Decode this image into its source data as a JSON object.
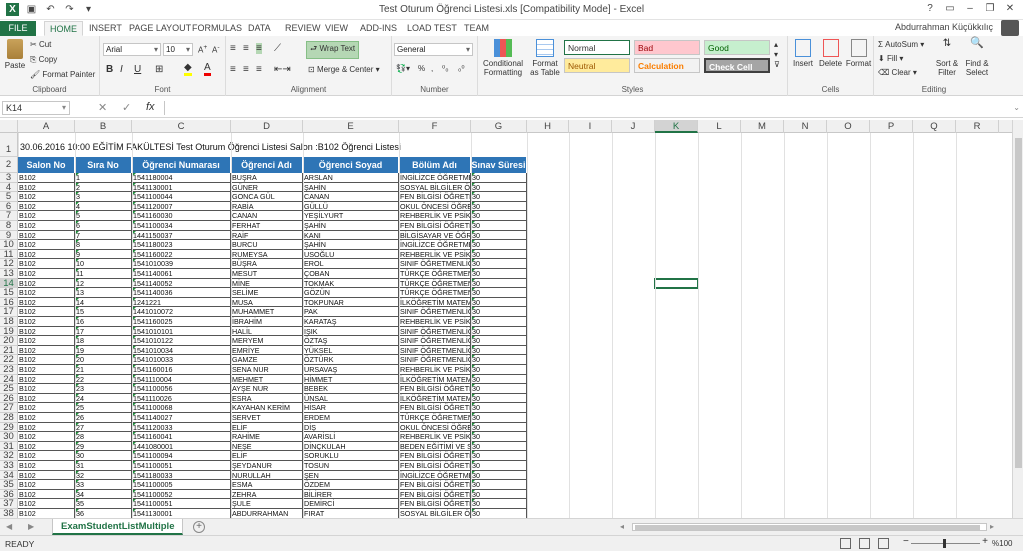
{
  "window": {
    "title": "Test Oturum  Öğrenci Listesi.xls  [Compatibility Mode] - Excel",
    "user": "Abdurrahman Küçükkılıç"
  },
  "tabs": [
    "FILE",
    "HOME",
    "INSERT",
    "PAGE LAYOUT",
    "FORMULAS",
    "DATA",
    "REVIEW",
    "VIEW",
    "ADD-INS",
    "LOAD TEST",
    "TEAM"
  ],
  "ribbon": {
    "clipboard": {
      "paste": "Paste",
      "cut": "Cut",
      "copy": "Copy",
      "format_painter": "Format Painter",
      "label": "Clipboard"
    },
    "font": {
      "name": "Arial",
      "size": "10",
      "label": "Font",
      "bold": "B",
      "italic": "I",
      "underline": "U"
    },
    "alignment": {
      "wrap": "Wrap Text",
      "merge": "Merge & Center",
      "label": "Alignment"
    },
    "number": {
      "format": "General",
      "label": "Number",
      "pct": "%"
    },
    "styles": {
      "cond": "Conditional Formatting",
      "table": "Format as Table",
      "label": "Styles",
      "normal": "Normal",
      "bad": "Bad",
      "good": "Good",
      "neutral": "Neutral",
      "calculation": "Calculation",
      "check": "Check Cell"
    },
    "cells": {
      "insert": "Insert",
      "delete": "Delete",
      "format": "Format",
      "label": "Cells"
    },
    "editing": {
      "autosum": "AutoSum",
      "fill": "Fill",
      "clear": "Clear",
      "sort": "Sort & Filter",
      "find": "Find & Select",
      "label": "Editing"
    }
  },
  "formula_bar": {
    "name_box": "K14",
    "fx": "fx",
    "content": ""
  },
  "columns": [
    "A",
    "B",
    "C",
    "D",
    "E",
    "F",
    "G",
    "H",
    "I",
    "J",
    "K",
    "L",
    "M",
    "N",
    "O",
    "P",
    "Q",
    "R"
  ],
  "selected_column": "K",
  "selected_row": "14",
  "sheet_title": "30.06.2016 10:00 EĞİTİM FAKÜLTESİ Test Oturum  Öğrenci Listesi Salon :B102 Öğrenci Listesi",
  "table_headers": [
    "Salon No",
    "Sıra No",
    "Öğrenci Numarası",
    "Öğrenci Adı",
    "Öğrenci Soyad",
    "Bölüm Adı",
    "Sınav Süresi"
  ],
  "rows": [
    [
      "B102",
      "1",
      "1541180004",
      "BUŞRA",
      "ARSLAN",
      "İNGİLİZCE ÖĞRETMENLİĞİ",
      "30"
    ],
    [
      "B102",
      "2",
      "1541130001",
      "GÜNER",
      "ŞAHİN",
      "SOSYAL BİLGİLER ÖĞRETMENLİĞİ",
      "30"
    ],
    [
      "B102",
      "3",
      "1541100044",
      "GONCA GÜL",
      "CANAN",
      "FEN BİLGİSİ ÖĞRETMENLİĞİ",
      "30"
    ],
    [
      "B102",
      "4",
      "1541120007",
      "RABİA",
      "GÜLLÜ",
      "OKUL ÖNCESİ ÖĞRETMENLİĞİ",
      "30"
    ],
    [
      "B102",
      "5",
      "1541160030",
      "CANAN",
      "YEŞİLYURT",
      "REHBERLİK VE PSİKOLOJİK DAN.",
      "30"
    ],
    [
      "B102",
      "6",
      "1541100034",
      "FERHAT",
      "ŞAHİN",
      "FEN BİLGİSİ ÖĞRETMENLİĞİ",
      "30"
    ],
    [
      "B102",
      "7",
      "1441150037",
      "RAİF",
      "KANI",
      "BİLGİSAYAR VE ÖĞRETİM TEK.",
      "30"
    ],
    [
      "B102",
      "8",
      "1541180023",
      "BURCU",
      "ŞAHİN",
      "İNGİLİZCE ÖĞRETMENLİĞİ",
      "30"
    ],
    [
      "B102",
      "9",
      "1541160022",
      "RUMEYSA",
      "USOĞLU",
      "REHBERLİK VE PSİKOLOJİK DAN.",
      "30"
    ],
    [
      "B102",
      "10",
      "1541010039",
      "BÜŞRA",
      "EROL",
      "SINIF ÖĞRETMENLİĞİ",
      "30"
    ],
    [
      "B102",
      "11",
      "1541140061",
      "MESUT",
      "ÇOBAN",
      "TÜRKÇE ÖĞRETMENLİĞİ",
      "30"
    ],
    [
      "B102",
      "12",
      "1541140052",
      "MİNE",
      "TOKMAK",
      "TÜRKÇE ÖĞRETMENLİĞİ",
      "30"
    ],
    [
      "B102",
      "13",
      "1541140036",
      "SELİME",
      "GÖZÜN",
      "TÜRKÇE ÖĞRETMENLİĞİ",
      "30"
    ],
    [
      "B102",
      "14",
      "1241221",
      "MUSA",
      "TOKPUNAR",
      "İLKÖĞRETİM MATEMATİK",
      "30"
    ],
    [
      "B102",
      "15",
      "1441010072",
      "MUHAMMET",
      "PAK",
      "SINIF ÖĞRETMENLİĞİ",
      "30"
    ],
    [
      "B102",
      "16",
      "1541160025",
      "İBRAHİM",
      "KARATAŞ",
      "REHBERLİK VE PSİKOLOJİK DAN.",
      "30"
    ],
    [
      "B102",
      "17",
      "1541010101",
      "HALİL",
      "IŞIK",
      "SINIF ÖĞRETMENLİĞİ",
      "30"
    ],
    [
      "B102",
      "18",
      "1541010122",
      "MERYEM",
      "ÖZTAŞ",
      "SINIF ÖĞRETMENLİĞİ",
      "30"
    ],
    [
      "B102",
      "19",
      "1541010034",
      "EMRİYE",
      "YÜKSEL",
      "SINIF ÖĞRETMENLİĞİ",
      "30"
    ],
    [
      "B102",
      "20",
      "1541010033",
      "GAMZE",
      "ÖZTÜRK",
      "SINIF ÖĞRETMENLİĞİ",
      "30"
    ],
    [
      "B102",
      "21",
      "1541160016",
      "SENA NUR",
      "URSAVAŞ",
      "REHBERLİK VE PSİKOLOJİK DAN.",
      "30"
    ],
    [
      "B102",
      "22",
      "1541110004",
      "MEHMET",
      "HİMMET",
      "İLKÖĞRETİM MATEMATİK",
      "30"
    ],
    [
      "B102",
      "23",
      "1541100056",
      "AYŞE NUR",
      "BEBEK",
      "FEN BİLGİSİ ÖĞRETMENLİĞİ",
      "30"
    ],
    [
      "B102",
      "24",
      "1541110026",
      "ESRA",
      "ÜNSAL",
      "İLKÖĞRETİM MATEMATİK",
      "30"
    ],
    [
      "B102",
      "25",
      "1541100068",
      "KAYAHAN KERİM",
      "HİSAR",
      "FEN BİLGİSİ ÖĞRETMENLİĞİ",
      "30"
    ],
    [
      "B102",
      "26",
      "1541140027",
      "SERVET",
      "ERDEM",
      "TÜRKÇE ÖĞRETMENLİĞİ",
      "30"
    ],
    [
      "B102",
      "27",
      "1541120033",
      "ELİF",
      "DİŞ",
      "OKUL ÖNCESİ ÖĞRETMENLİĞİ",
      "30"
    ],
    [
      "B102",
      "28",
      "1541160041",
      "RAHİME",
      "AVARİSLİ",
      "REHBERLİK VE PSİKOLOJİK DAN.",
      "30"
    ],
    [
      "B102",
      "29",
      "1441080001",
      "NEŞE",
      "DİNÇKULAH",
      "BEDEN EĞİTİMİ  VE SPOR ÖĞR.",
      "30"
    ],
    [
      "B102",
      "30",
      "1541100094",
      "ELİF",
      "SORUKLU",
      "FEN BİLGİSİ ÖĞRETMENLİĞİ",
      "30"
    ],
    [
      "B102",
      "31",
      "1541100051",
      "ŞEYDANUR",
      "TOSUN",
      "FEN BİLGİSİ ÖĞRETMENLİĞİ",
      "30"
    ],
    [
      "B102",
      "32",
      "1541180033",
      "NURULLAH",
      "ŞEN",
      "İNGİLİZCE ÖĞRETMENLİĞİ",
      "30"
    ],
    [
      "B102",
      "33",
      "1541100005",
      "ESMA",
      "ÖZDEM",
      "FEN BİLGİSİ ÖĞRETMENLİĞİ",
      "30"
    ],
    [
      "B102",
      "34",
      "1541100052",
      "ZEHRA",
      "BİLİRER",
      "FEN BİLGİSİ ÖĞRETMENLİĞİ",
      "30"
    ],
    [
      "B102",
      "35",
      "1541100051",
      "ŞULE",
      "DEMİRCİ",
      "FEN BİLGİSİ ÖĞRETMENLİĞİ",
      "30"
    ],
    [
      "B102",
      "36",
      "1541130001",
      "ABDURRAHMAN",
      "FIRAT",
      "SOSYAL BİLGİLER ÖĞRETMENLİĞİ",
      "30"
    ]
  ],
  "row_numbers": [
    "1",
    "2",
    "3",
    "4",
    "5",
    "6",
    "7",
    "8",
    "9",
    "10",
    "11",
    "12",
    "13",
    "14",
    "15",
    "16",
    "17",
    "18",
    "19",
    "20",
    "21",
    "22",
    "23",
    "24",
    "25",
    "26",
    "27",
    "28",
    "29",
    "30",
    "31",
    "32",
    "33",
    "34",
    "35",
    "36",
    "37",
    "38"
  ],
  "sheet_tab": "ExamStudentListMultiple",
  "status": {
    "ready": "READY",
    "zoom": "%100"
  },
  "colors": {
    "accent": "#217346",
    "header_fill": "#2e75b6"
  }
}
